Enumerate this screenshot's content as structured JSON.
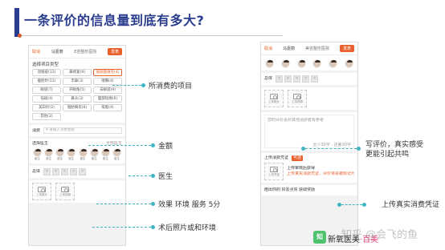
{
  "slide": {
    "title": "一条评价的信息量到底有多大?"
  },
  "left_phone": {
    "cancel": "取消",
    "name": "马嘉丽",
    "hospital": "E容整形医院",
    "publish": "发表",
    "project_title": "选择项目类型",
    "projects": [
      "双眼皮(12)",
      "鼻修复(9)",
      "玻尿酸填充(4)",
      "瘦脸针(11)",
      "丰鼻(3)",
      "隆胸(4)",
      "眼袋(7)",
      "开眼角(5)",
      "去眼袋(9)",
      "祛斑(4)",
      "鼻头(3)",
      "面部轮廓(6)",
      "美白针(2)",
      "脂肪填充(6)",
      "吸脂(4)",
      "其他(2)"
    ],
    "money_label": "消费",
    "money_placeholder": "¥ 请输入消费金额",
    "doctor_title": "选择医生",
    "doctor_more": "全部医生",
    "doctors": [
      "医生",
      "医生",
      "医生",
      "医生",
      "医生",
      "医生",
      "医生",
      "医生"
    ],
    "score_label": "总体",
    "upload_before": "上传照片",
    "upload_after": "上传视频"
  },
  "right_phone": {
    "cancel": "取消",
    "name": "马嘉丽",
    "hospital": "美容整形医院",
    "publish": "发表",
    "score_label": "总体",
    "upload_photo": "上传照片",
    "upload_video": "上传视频",
    "text_placeholder": "您的评价会对其他消费者有参考",
    "text_hint": "至少30字 · 还差30字",
    "receipt_title": "上传消费凭证",
    "receipt_badge": "可选",
    "receipt_box": "上传凭证",
    "receipt_text1": "上传审核后获得",
    "receipt_text2": "上传真实消费凭证，评价将会被标记为真实",
    "footer": "晒出你的  好友点赞 获取奖励"
  },
  "callouts": {
    "project": "所消费的项目",
    "money": "金额",
    "doctor": "医生",
    "score": "效果 环境 服务 5分",
    "photos": "术后照片或和环境",
    "review_line1": "写评价，真实感受",
    "review_line2": "更能引起共鸣",
    "receipt": "上传真实消费凭证"
  },
  "branding": {
    "logo_mark": "知",
    "logo_text": "新氧医美",
    "logo_brand": "·百美",
    "watermark": "知乎 @会飞的鱼"
  },
  "colors": {
    "title": "#2a3d8f",
    "accent": "#e8602c",
    "callout": "#3fb5c4"
  }
}
